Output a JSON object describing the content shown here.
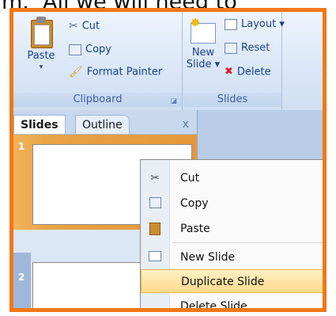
{
  "caption": "m.  All we will need to",
  "ribbon": {
    "clipboard": {
      "group_label": "Clipboard",
      "paste_label": "Paste",
      "paste_arrow": "▾",
      "cut_label": "Cut",
      "copy_label": "Copy",
      "format_painter_label": "Format Painter"
    },
    "slides": {
      "group_label": "Slides",
      "new_slide_label": "New",
      "new_slide_label2": "Slide ▾",
      "layout_label": "Layout ▾",
      "reset_label": "Reset",
      "delete_label": "Delete"
    }
  },
  "pane": {
    "tab_slides": "Slides",
    "tab_outline": "Outline",
    "close": "x",
    "slide_numbers": [
      "1",
      "2"
    ]
  },
  "context_menu": {
    "items": [
      {
        "label": "Cut",
        "icon": "scissors-icon"
      },
      {
        "label": "Copy",
        "icon": "copy-icon"
      },
      {
        "label": "Paste",
        "icon": "paste-icon"
      },
      {
        "label": "New Slide",
        "icon": "new-slide-icon"
      },
      {
        "label": "Duplicate Slide",
        "icon": "",
        "highlighted": true
      },
      {
        "label": "Delete Slide",
        "icon": ""
      }
    ]
  },
  "colors": {
    "frame": "#f07818",
    "highlight": "#ffd98a",
    "selected_slide": "#e9a244"
  }
}
